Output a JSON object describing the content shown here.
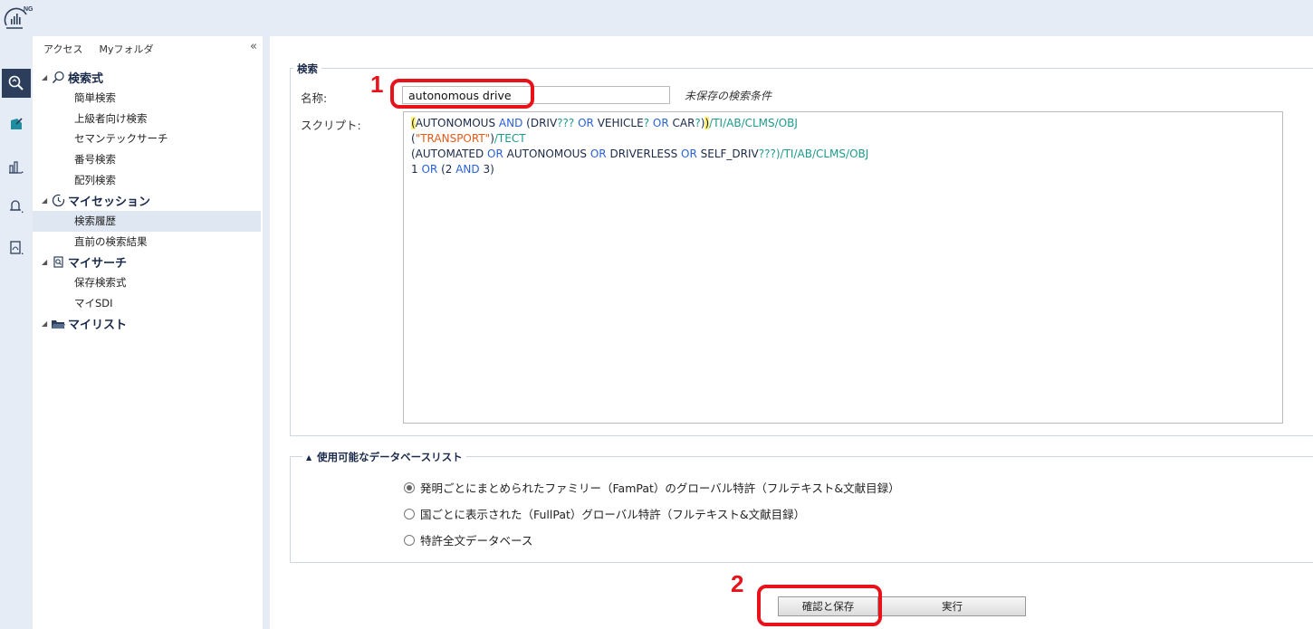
{
  "app": {
    "logo_text": "NG"
  },
  "left_panel": {
    "tabs": [
      "アクセス",
      "Myフォルダ"
    ],
    "collapse_glyph": "«",
    "tree": [
      {
        "label": "検索式",
        "type": "parent",
        "icon": "search-icon"
      },
      {
        "label": "簡単検索",
        "type": "child"
      },
      {
        "label": "上級者向け検索",
        "type": "child"
      },
      {
        "label": "セマンテックサーチ",
        "type": "child"
      },
      {
        "label": "番号検索",
        "type": "child"
      },
      {
        "label": "配列検索",
        "type": "child"
      },
      {
        "label": "マイセッション",
        "type": "parent",
        "icon": "clock-icon"
      },
      {
        "label": "検索履歴",
        "type": "child",
        "selected": true
      },
      {
        "label": "直前の検索結果",
        "type": "child"
      },
      {
        "label": "マイサーチ",
        "type": "parent",
        "icon": "saved-search-icon"
      },
      {
        "label": "保存検索式",
        "type": "child"
      },
      {
        "label": "マイSDI",
        "type": "child"
      },
      {
        "label": "マイリスト",
        "type": "parent",
        "icon": "folder-icon"
      }
    ]
  },
  "search": {
    "legend": "検索",
    "name_label": "名称:",
    "name_value": "autonomous drive",
    "unsaved_note": "未保存の検索条件",
    "script_label": "スクリプト:",
    "script_lines": [
      "(AUTONOMOUS AND (DRIV??? OR VEHICLE? OR CAR?))/TI/AB/CLMS/OBJ",
      "(\"TRANSPORT\")/TECT",
      "(AUTOMATED OR AUTONOMOUS OR DRIVERLESS OR SELF_DRIV???)/TI/AB/CLMS/OBJ",
      "1 OR (2 AND 3)"
    ]
  },
  "databases": {
    "legend": "使用可能なデータベースリスト",
    "options": [
      {
        "label": "発明ごとにまとめられたファミリー（FamPat）のグローバル特許（フルテキスト&文献目録）",
        "selected": true
      },
      {
        "label": "国ごとに表示された（FullPat）グローバル特許（フルテキスト&文献目録）",
        "selected": false
      },
      {
        "label": "特許全文データベース",
        "selected": false
      }
    ]
  },
  "buttons": {
    "confirm_save": "確認と保存",
    "run": "実行"
  },
  "annotations": {
    "marker_1": "1",
    "marker_2": "2"
  },
  "colors": {
    "accent_red": "#e8121b",
    "nav_bg": "#e6ecf5",
    "active_icon_bg": "#2c3e5c"
  }
}
